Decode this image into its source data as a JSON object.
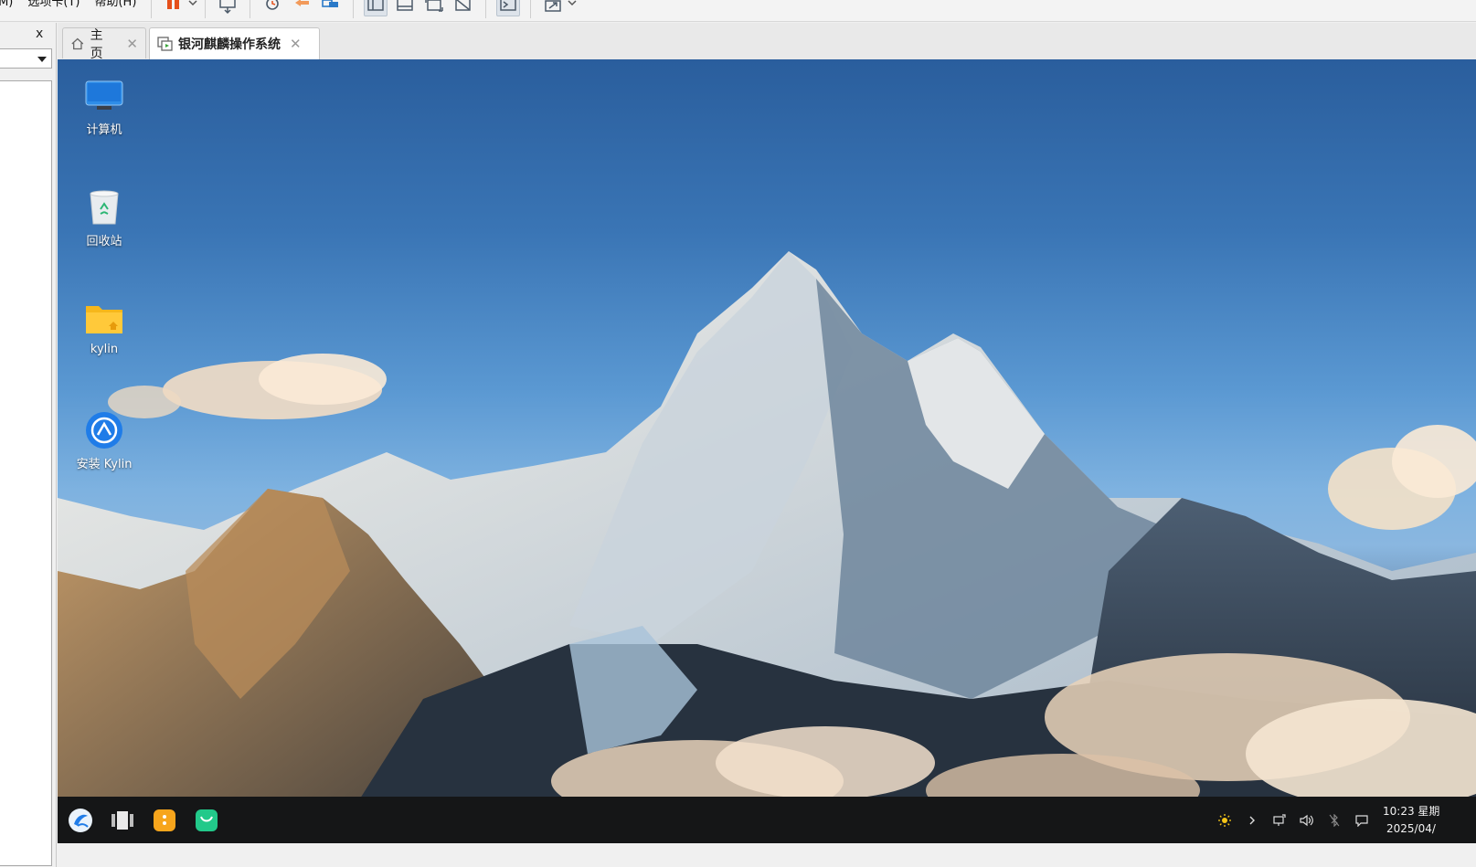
{
  "menu": {
    "items": [
      {
        "label": "虚拟机(M)"
      },
      {
        "label": "选项卡(T)"
      },
      {
        "label": "帮助(H)"
      }
    ]
  },
  "library": {
    "close_glyph": "x",
    "select_value": ""
  },
  "tabs": [
    {
      "label": "主页",
      "icon": "home-icon",
      "active": false
    },
    {
      "label": "银河麒麟操作系统",
      "icon": "vm-running-icon",
      "active": true
    }
  ],
  "desktop": {
    "icons": [
      {
        "label": "计算机",
        "icon": "computer-icon"
      },
      {
        "label": "回收站",
        "icon": "trash-icon"
      },
      {
        "label": "kylin",
        "icon": "home-folder-icon"
      },
      {
        "label": "安装 Kylin",
        "icon": "installer-icon"
      }
    ]
  },
  "taskbar": {
    "apps": [
      {
        "name": "start-menu-icon"
      },
      {
        "name": "multitask-view-icon"
      },
      {
        "name": "file-manager-icon"
      },
      {
        "name": "software-store-icon"
      }
    ],
    "tray": [
      "brightness-icon",
      "expand-tray-icon",
      "network-icon",
      "volume-icon",
      "bluetooth-icon",
      "notification-icon"
    ],
    "clock": {
      "time": "10:23 星期",
      "date": "2025/04/"
    }
  },
  "colors": {
    "accent": "#3a75b5",
    "taskbar": "#151617",
    "folder": "#f6b71b",
    "store": "#22c98a"
  }
}
